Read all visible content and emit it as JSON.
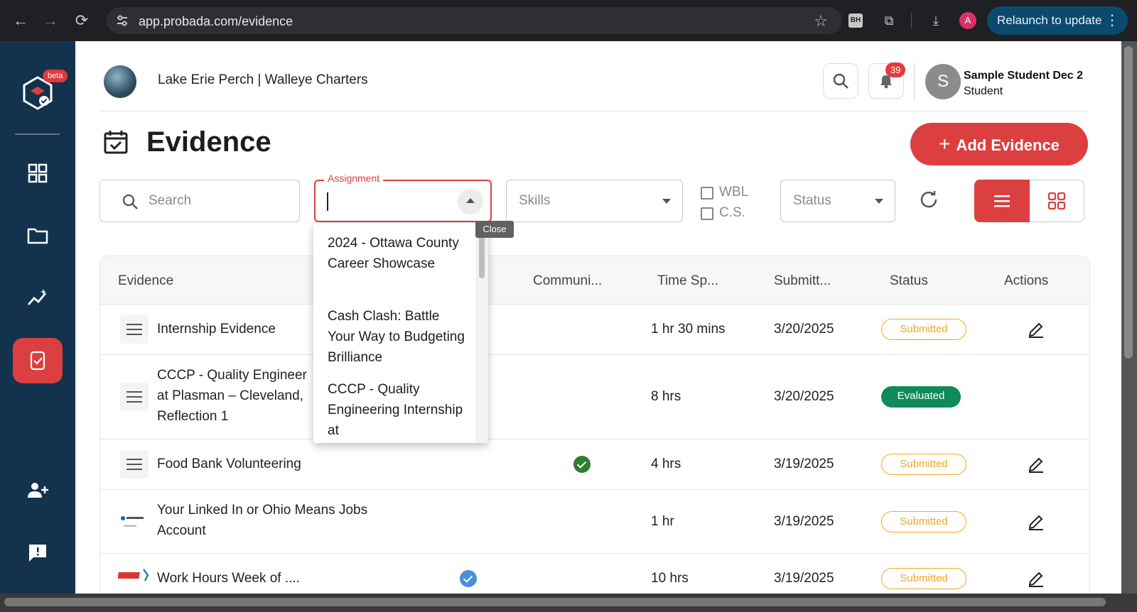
{
  "browser": {
    "url": "app.probada.com/evidence",
    "profile_initial": "A",
    "ext_label": "BH",
    "relaunch_label": "Relaunch to update"
  },
  "sidebar": {
    "beta_label": "beta",
    "items": [
      {
        "name": "dashboard",
        "icon": "grid-icon"
      },
      {
        "name": "portfolio",
        "icon": "folder-icon"
      },
      {
        "name": "skills",
        "icon": "trend-icon"
      },
      {
        "name": "evidence",
        "icon": "evidence-icon",
        "active": true
      },
      {
        "name": "invite",
        "icon": "add-user-icon"
      },
      {
        "name": "feedback",
        "icon": "feedback-icon"
      }
    ]
  },
  "header": {
    "org_name": "Lake Erie Perch | Walleye Charters",
    "notification_count": "39",
    "user_initial": "S",
    "user_name": "Sample Student Dec 2",
    "user_role": "Student"
  },
  "page": {
    "title": "Evidence",
    "add_button": "Add Evidence",
    "add_icon": "+"
  },
  "filters": {
    "search_placeholder": "Search",
    "assignment_label": "Assignment",
    "assignment_value": "",
    "skills_placeholder": "Skills",
    "wbl_label": "WBL",
    "cs_label": "C.S.",
    "status_placeholder": "Status",
    "close_tooltip": "Close"
  },
  "assignment_options": [
    "2024 - Ottawa County Career Showcase",
    "Cash Clash: Battle Your Way to Budgeting Brilliance",
    "CCCP - Quality Engineering Internship at"
  ],
  "table": {
    "headers": {
      "evidence": "Evidence",
      "community": "Communi...",
      "time": "Time Sp...",
      "submitted": "Submitt...",
      "status": "Status",
      "actions": "Actions"
    },
    "rows": [
      {
        "title": "Internship Evidence",
        "time": "1 hr 30 mins",
        "date": "3/20/2025",
        "status": "Submitted"
      },
      {
        "title_line1": "CCCP - Quality Engineer",
        "title_line2": "at Plasman – Cleveland,",
        "title_line3": "Reflection 1",
        "time": "8 hrs",
        "date": "3/20/2025",
        "status": "Evaluated"
      },
      {
        "title": "Food Bank Volunteering",
        "time": "4 hrs",
        "date": "3/19/2025",
        "status": "Submitted"
      },
      {
        "title_line1": "Your Linked In or Ohio Means Jobs",
        "title_line2": "Account",
        "time": "1 hr",
        "date": "3/19/2025",
        "status": "Submitted"
      },
      {
        "title": "Work Hours Week of ....",
        "time": "10 hrs",
        "date": "3/19/2025",
        "status": "Submitted"
      }
    ]
  },
  "colors": {
    "accent": "#dc3f3f",
    "sidebar": "#12324e",
    "submitted": "#f5a623",
    "evaluated": "#0f8a5a"
  }
}
